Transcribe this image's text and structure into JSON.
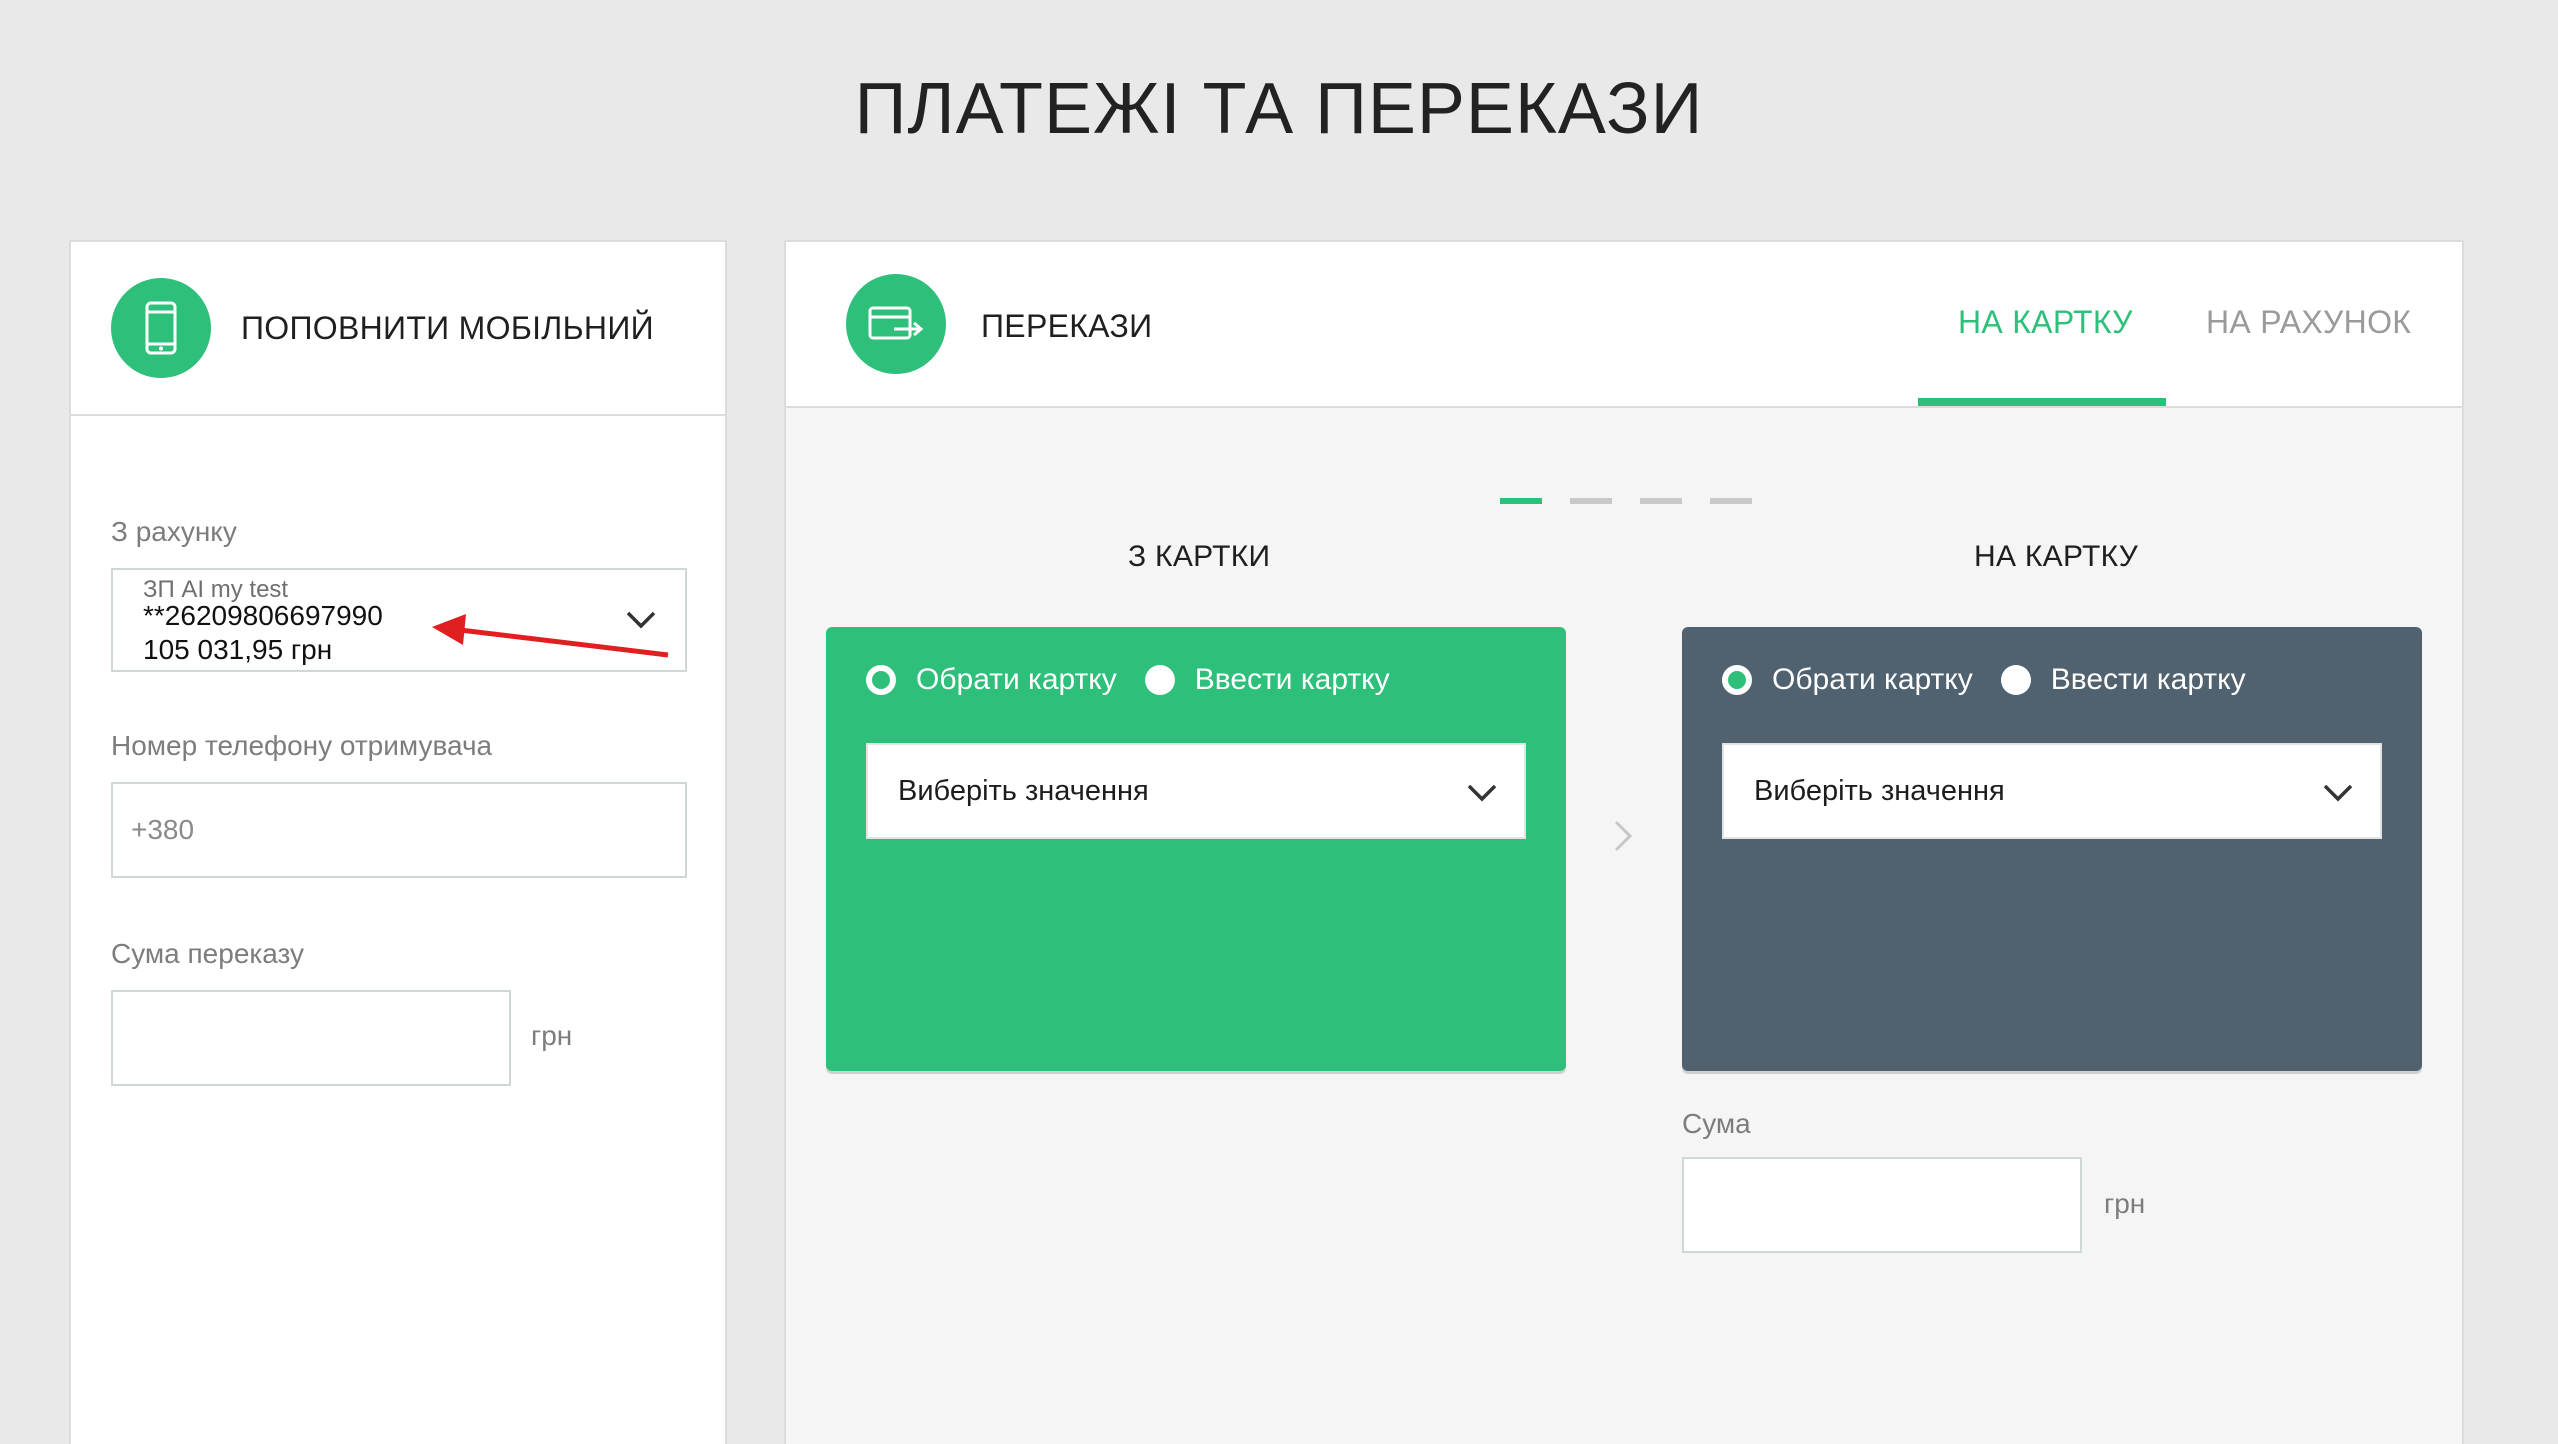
{
  "page": {
    "title": "ПЛАТЕЖІ ТА ПЕРЕКАЗИ"
  },
  "mobile": {
    "title": "ПОПОВНИТИ МОБІЛЬНИЙ",
    "icon": "smartphone-icon",
    "from_account_label": "З рахунку",
    "account": {
      "name": "ЗП AI my test",
      "number": "**26209806697990",
      "balance": "105 031,95 грн"
    },
    "phone_label": "Номер телефону отримувача",
    "phone_placeholder": "+380",
    "amount_label": "Сума переказу",
    "amount_unit": "грн"
  },
  "transfers": {
    "title": "ПЕРЕКАЗИ",
    "icon": "card-transfer-icon",
    "tabs": [
      {
        "label": "НА КАРТКУ",
        "active": true
      },
      {
        "label": "НА РАХУНОК",
        "active": false
      }
    ],
    "steps": {
      "current": 1,
      "total": 4
    },
    "from": {
      "title": "З КАРТКИ",
      "option_choose": "Обрати картку",
      "option_enter": "Ввести картку",
      "selected_option": "Обрати картку",
      "select_placeholder": "Виберіть значення"
    },
    "to": {
      "title": "НА КАРТКУ",
      "option_choose": "Обрати картку",
      "option_enter": "Ввести картку",
      "selected_option": "Обрати картку",
      "select_placeholder": "Виберіть значення"
    },
    "amount_label": "Сума",
    "amount_unit": "грн"
  },
  "colors": {
    "accent": "#2ec07b",
    "slate_card": "#50616f",
    "background": "#e9e9e9",
    "annotation_arrow": "#e02020"
  }
}
